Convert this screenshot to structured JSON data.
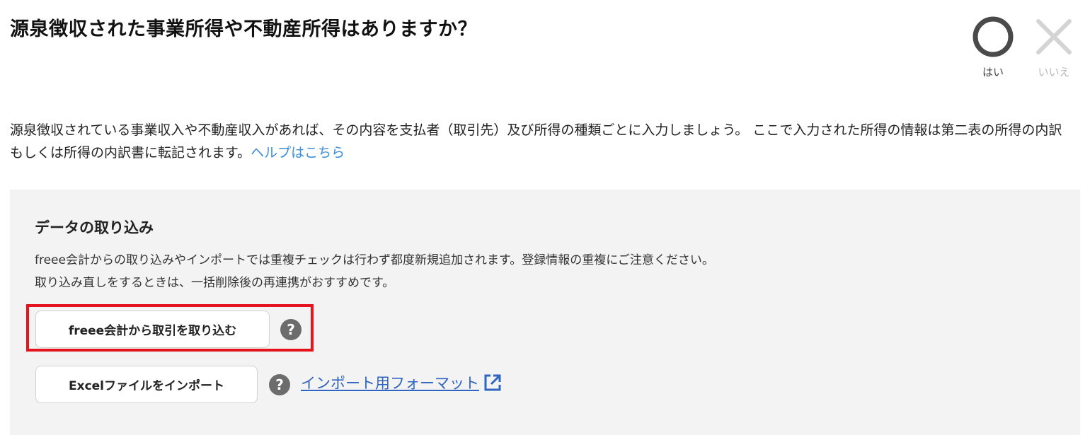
{
  "question": {
    "title": "源泉徴収された事業所得や不動産所得はありますか？"
  },
  "answers": {
    "yes_label": "はい",
    "no_label": "いいえ",
    "yes_icon": "circle-icon",
    "no_icon": "cross-icon"
  },
  "description": {
    "text": "源泉徴収されている事業収入や不動産収入があれば、その内容を支払者（取引先）及び所得の種類ごとに入力しましょう。 ここで入力された所得の情報は第二表の所得の内訳もしくは所得の内訳書に転記されます。",
    "help_link": "ヘルプはこちら"
  },
  "import_panel": {
    "heading": "データの取り込み",
    "note_line1": "freee会計からの取り込みやインポートでは重複チェックは行わず都度新規追加されます。登録情報の重複にご注意ください。",
    "note_line2": "取り込み直しをするときは、一括削除後の再連携がおすすめです。",
    "freee_import_button": "freee会計から取引を取り込む",
    "excel_import_button": "Excelファイルをインポート",
    "format_link": "インポート用フォーマット",
    "help_icon_glyph": "?"
  },
  "colors": {
    "highlight": "#e3141c",
    "help_link": "#3d8ed6",
    "format_link": "#2f64c0",
    "panel_background": "#f4f3f3"
  }
}
